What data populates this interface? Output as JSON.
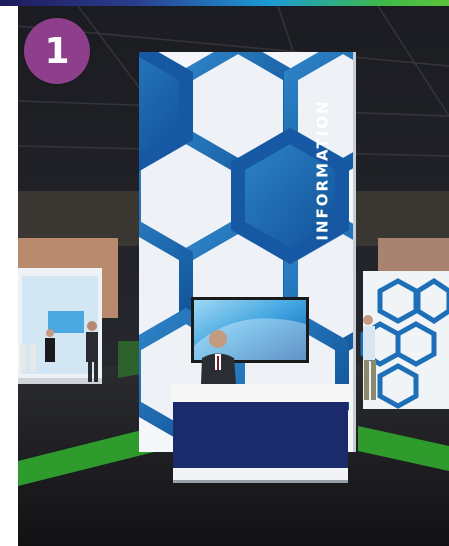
{
  "badge": {
    "number": "1",
    "color": "#8e3f8c"
  },
  "tower": {
    "label": "INFORMATION"
  },
  "palette": {
    "accent_blue": "#1d6fb8",
    "hex_deep_blue": "#0f4e96",
    "counter_navy": "#1b2a6b",
    "turf_green": "#2f9b2c"
  }
}
